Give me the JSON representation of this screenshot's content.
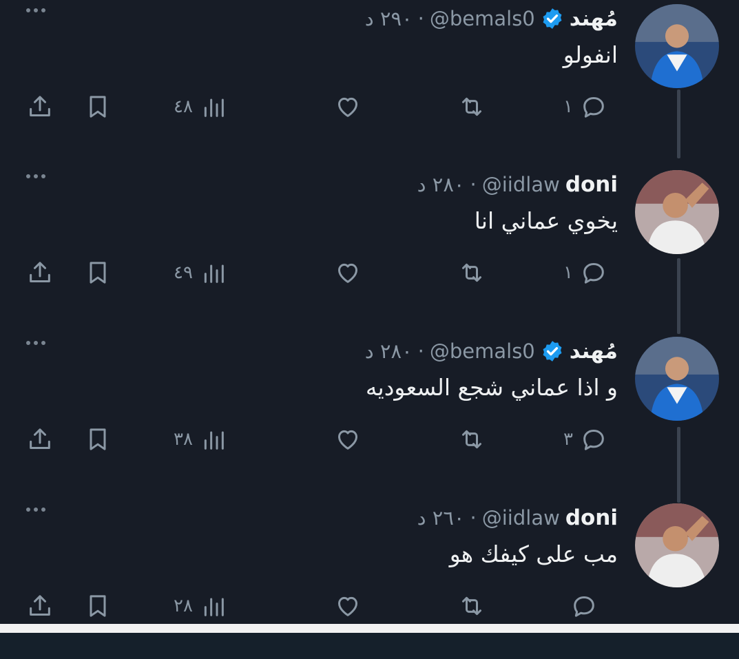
{
  "tweets": [
    {
      "name": "مُهند",
      "verified": true,
      "handle": "@bemals0",
      "time": "٢٩٠ د",
      "text": "انفولو",
      "replies": "١",
      "views": "٤٨"
    },
    {
      "name": "doni",
      "verified": false,
      "handle": "@iidlaw",
      "time": "٢٨٠ د",
      "text": "يخوي عماني انا",
      "replies": "١",
      "views": "٤٩"
    },
    {
      "name": "مُهند",
      "verified": true,
      "handle": "@bemals0",
      "time": "٢٨٠ د",
      "text": "و اذا عماني شجع السعوديه",
      "replies": "٣",
      "views": "٣٨"
    },
    {
      "name": "doni",
      "verified": false,
      "handle": "@iidlaw",
      "time": "٢٦٠ د",
      "text": "مب على كيفك هو",
      "replies": "",
      "views": "٢٨"
    }
  ],
  "icons": {
    "reply": "reply-icon",
    "retweet": "retweet-icon",
    "like": "like-icon",
    "views": "views-icon",
    "bookmark": "bookmark-icon",
    "share": "share-icon",
    "more": "more-icon",
    "verified": "verified-badge-icon"
  },
  "colors": {
    "background": "#171c26",
    "text": "#e7e9ea",
    "muted": "#8b98a5",
    "verified": "#1d9bf0"
  }
}
